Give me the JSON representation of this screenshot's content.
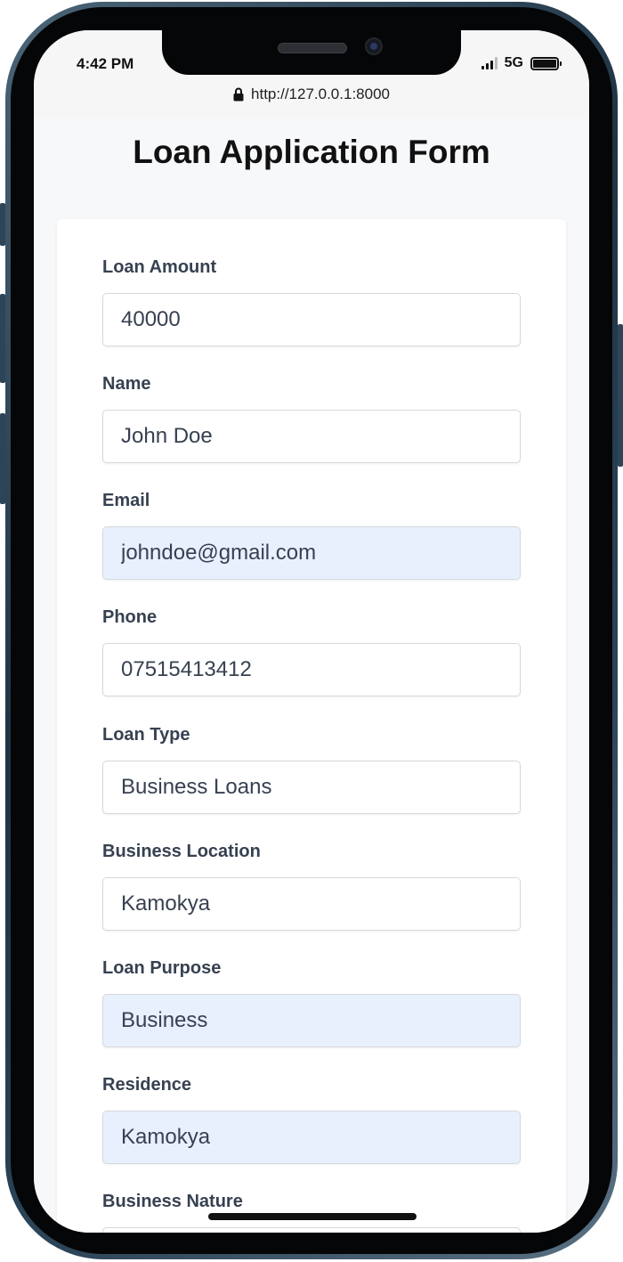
{
  "status_bar": {
    "time": "4:42 PM",
    "network": "5G"
  },
  "browser": {
    "url": "http://127.0.0.1:8000"
  },
  "form": {
    "title": "Loan Application Form",
    "fields": [
      {
        "label": "Loan Amount",
        "value": "40000",
        "autofilled": false
      },
      {
        "label": "Name",
        "value": "John Doe",
        "autofilled": false
      },
      {
        "label": "Email",
        "value": "johndoe@gmail.com",
        "autofilled": true
      },
      {
        "label": "Phone",
        "value": "07515413412",
        "autofilled": false
      },
      {
        "label": "Loan Type",
        "value": "Business Loans",
        "autofilled": false
      },
      {
        "label": "Business Location",
        "value": "Kamokya",
        "autofilled": false
      },
      {
        "label": "Loan Purpose",
        "value": "Business",
        "autofilled": true
      },
      {
        "label": "Residence",
        "value": "Kamokya",
        "autofilled": true
      },
      {
        "label": "Business Nature",
        "value": "",
        "autofilled": false
      }
    ]
  },
  "colors": {
    "autofill_background": "#e8f0fe",
    "label_text": "#374151",
    "page_background": "#f7f8fa"
  }
}
